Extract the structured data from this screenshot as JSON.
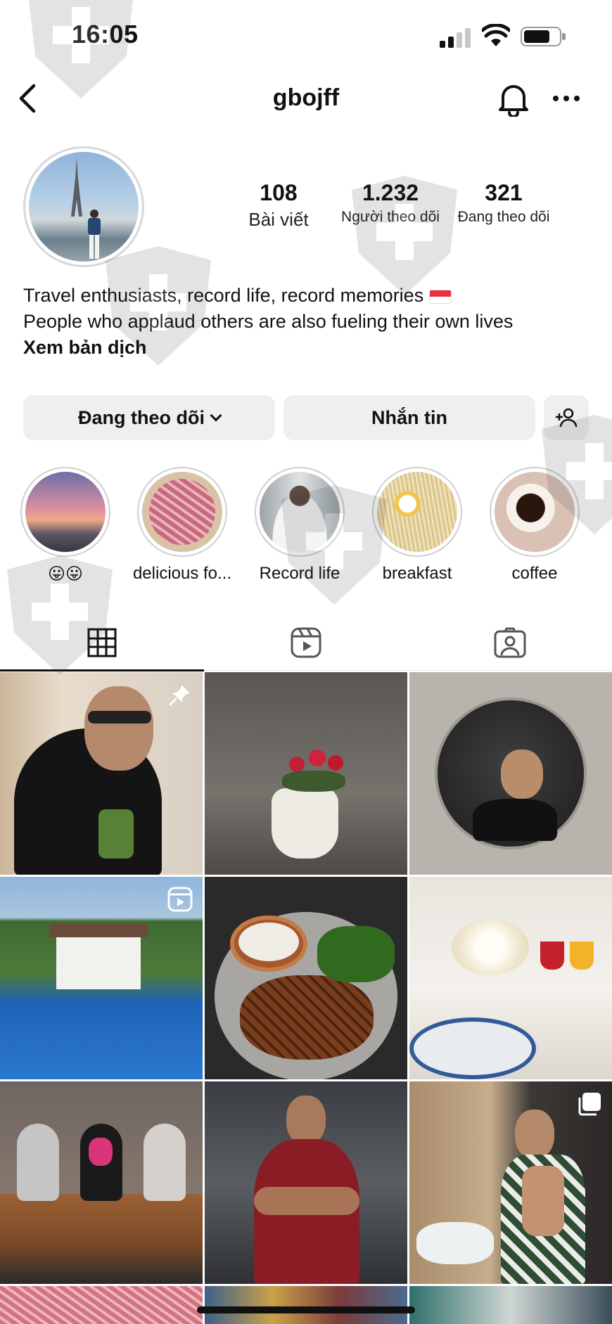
{
  "status_bar": {
    "time": "16:05"
  },
  "header": {
    "username": "gbojff"
  },
  "profile": {
    "stats": [
      {
        "value": "108",
        "label": "Bài viết"
      },
      {
        "value": "1.232",
        "label": "Người theo dõi"
      },
      {
        "value": "321",
        "label": "Đang theo dõi"
      }
    ],
    "bio": {
      "line1": "Travel enthusiasts, record life, record memories",
      "line2": "People who applaud others are also fueling their own lives",
      "translate": "Xem bản dịch"
    }
  },
  "actions": {
    "following_label": "Đang theo dõi",
    "message_label": "Nhắn tin"
  },
  "highlights": [
    {
      "label": "😛😛",
      "icon": "sunset-image"
    },
    {
      "label": "delicious fo...",
      "icon": "meat-image"
    },
    {
      "label": "Record life",
      "icon": "portrait-image"
    },
    {
      "label": "breakfast",
      "icon": "noodles-image"
    },
    {
      "label": "coffee",
      "icon": "coffee-image"
    }
  ],
  "tabs": [
    {
      "name": "posts-grid",
      "icon": "grid-icon",
      "active": true
    },
    {
      "name": "reels",
      "icon": "reels-icon",
      "active": false
    },
    {
      "name": "tagged",
      "icon": "tagged-person-icon",
      "active": false
    }
  ],
  "grid_posts": [
    {
      "subject": "man in black shirt with green drink",
      "badge": "pin-icon"
    },
    {
      "subject": "red roses in white vase",
      "badge": ""
    },
    {
      "subject": "mirror selfie",
      "badge": ""
    },
    {
      "subject": "hotel pool",
      "badge": "reel-icon"
    },
    {
      "subject": "grilled steak plate",
      "badge": ""
    },
    {
      "subject": "white roses and juice glasses",
      "badge": ""
    },
    {
      "subject": "bear figurines",
      "badge": ""
    },
    {
      "subject": "man in red gym shirt",
      "badge": ""
    },
    {
      "subject": "bathroom selfie",
      "badge": "carousel-icon"
    }
  ],
  "colors": {
    "button_bg": "#efefef",
    "text": "#111111",
    "flag_red": "#e4333f"
  }
}
